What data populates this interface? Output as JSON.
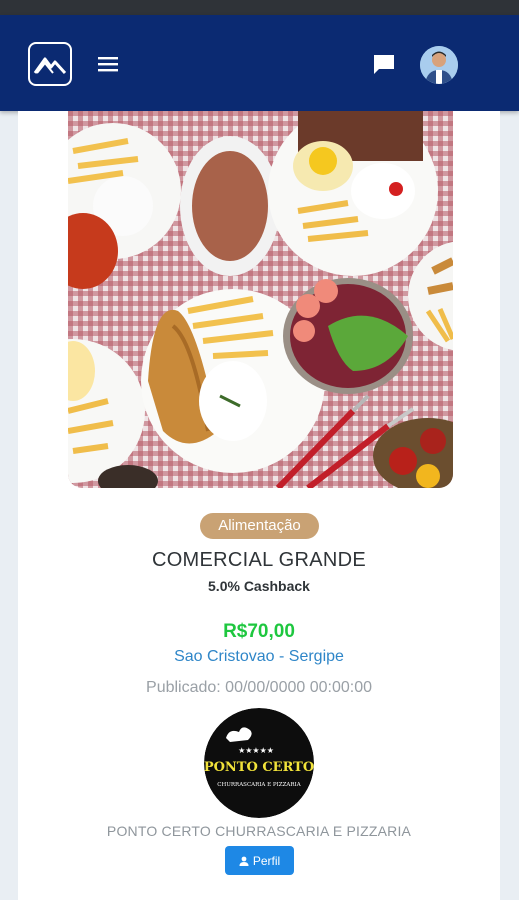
{
  "header": {
    "logo_icon": "mountain-logo-icon",
    "menu_icon": "hamburger-menu-icon",
    "chat_icon": "chat-bubble-icon",
    "avatar_icon": "user-avatar"
  },
  "offer": {
    "image_icon": "food-plates-photo",
    "category": "Alimentação",
    "title": "COMERCIAL GRANDE",
    "cashback": "5.0% Cashback",
    "price": "R$70,00",
    "location": "Sao Cristovao - Sergipe",
    "published": "Publicado: 00/00/0000 00:00:00"
  },
  "store": {
    "logo_text": "PONTO CERTO",
    "logo_subtext": "CHURRASCARIA E PIZZARIA",
    "logo_stars": "★★★★★",
    "name": "PONTO CERTO CHURRASCARIA E PIZZARIA",
    "profile_label": "Perfil",
    "profile_icon": "person-icon"
  },
  "colors": {
    "navbar": "#0b2a72",
    "badge": "#c9a274",
    "price": "#1ec73f",
    "location": "#2f86c8",
    "profile_button": "#1e88e5"
  }
}
